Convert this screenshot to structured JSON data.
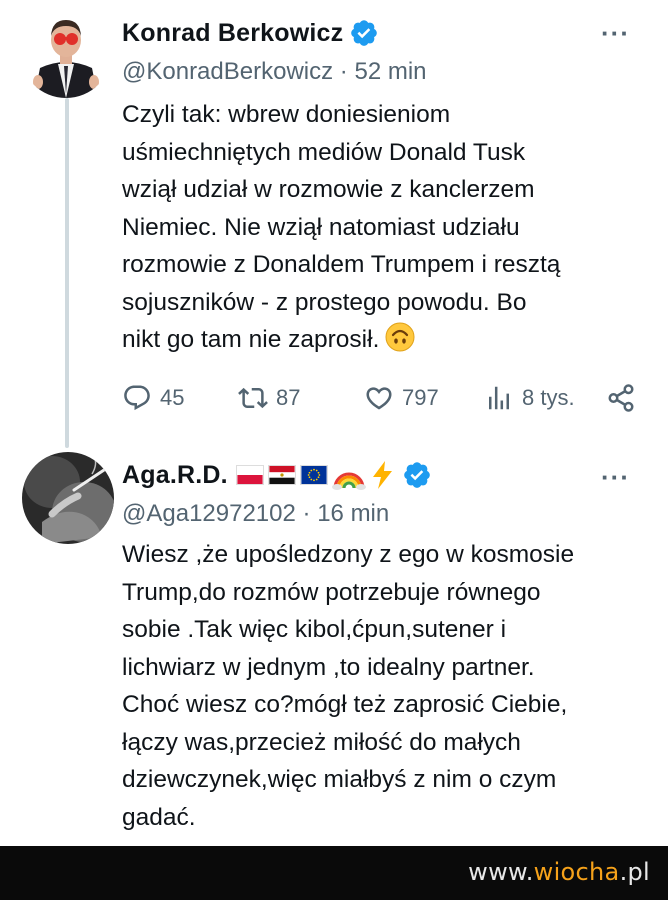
{
  "tweets": [
    {
      "author_name": "Konrad Berkowicz",
      "handle": "@KonradBerkowicz",
      "separator": "·",
      "time": "52 min",
      "more": "···",
      "lines": [
        "Czyli tak: wbrew doniesieniom",
        "uśmiechniętych mediów Donald Tusk",
        "wziął udział w rozmowie z kanclerzem",
        "Niemiec. Nie wziął natomiast udziału",
        "rozmowie z Donaldem Trumpem i resztą",
        "sojuszników - z prostego powodu. Bo",
        "nikt go tam nie zaprosił."
      ],
      "emoji": "upside-down-face-emoji",
      "actions": {
        "replies": "45",
        "retweets": "87",
        "likes": "797",
        "views": "8 tys."
      }
    },
    {
      "author_name": "Aga.R.D.",
      "handle": "@Aga12972102",
      "separator": "·",
      "time": "16 min",
      "more": "···",
      "name_emojis": [
        "poland-flag",
        "egypt-flag",
        "eu-flag",
        "rainbow",
        "lightning"
      ],
      "lines": [
        "Wiesz ,że upośledzony z ego w kosmosie",
        "Trump,do rozmów potrzebuje równego",
        "sobie .Tak więc kibol,ćpun,sutener i",
        "lichwiarz w jednym ,to idealny partner.",
        "Choć wiesz co?mógł też zaprosić Ciebie,",
        "łączy was,przecież miłość do małych",
        "dziewczynek,więc miałbyś z nim o czym",
        "gadać."
      ]
    }
  ],
  "watermark": {
    "prefix": "www.",
    "highlight": "wiocha",
    "suffix": ".pl"
  },
  "colors": {
    "verified": "#1d9bf0",
    "secondary_text": "#536471",
    "thread_line": "#cfd9de",
    "watermark_accent": "#f6a21a"
  }
}
